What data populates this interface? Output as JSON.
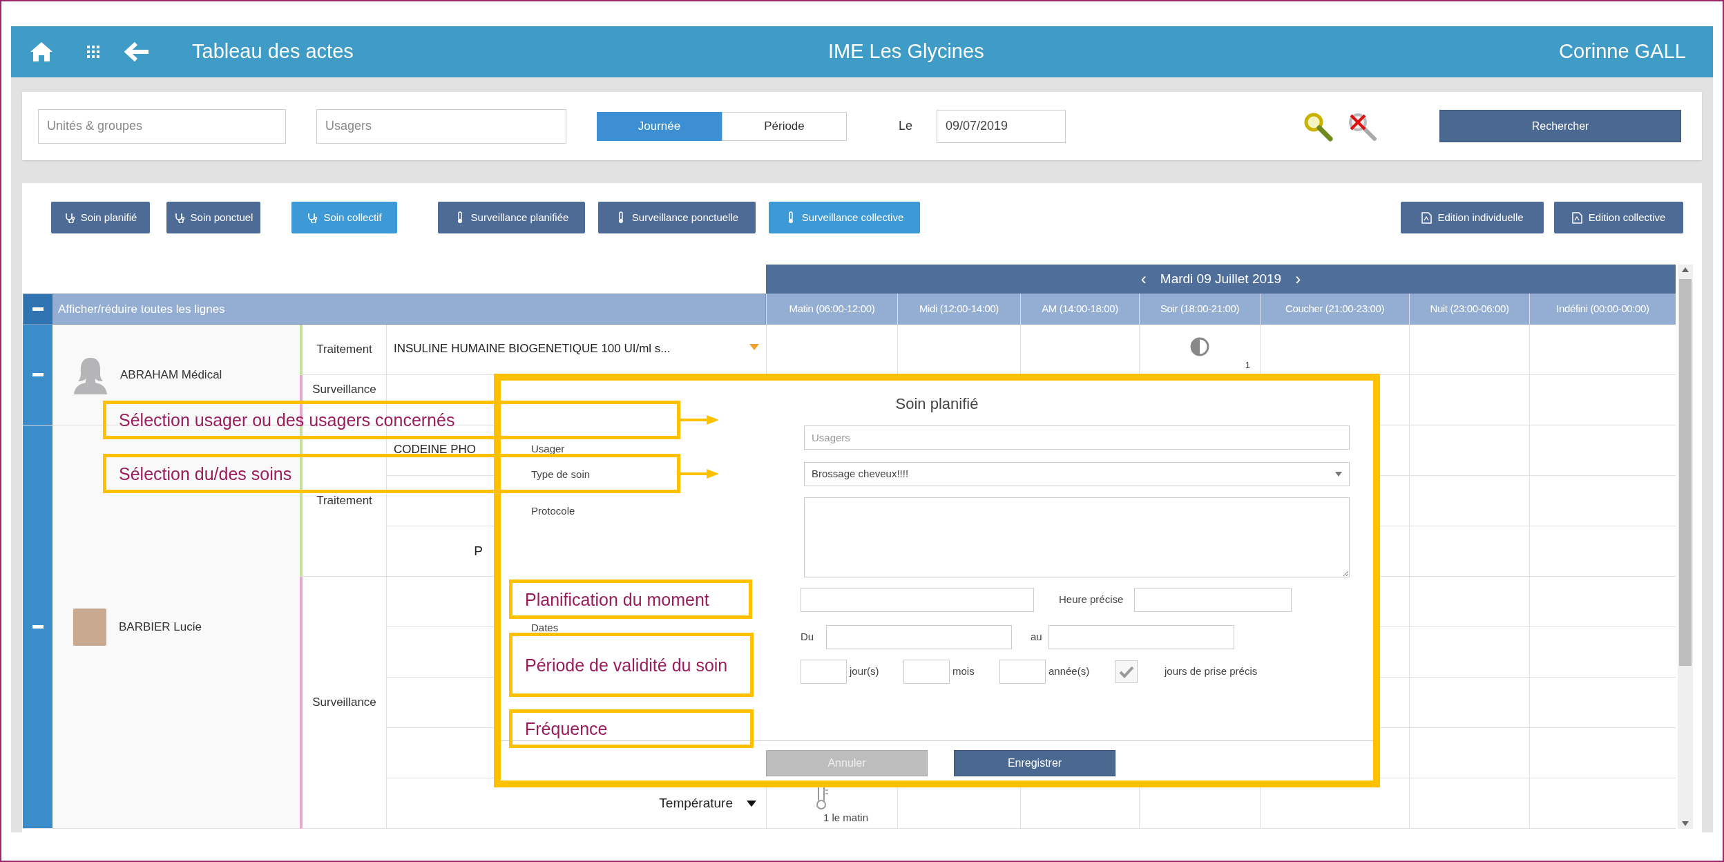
{
  "app_bar": {
    "title": "Tableau des actes",
    "center_title": "IME Les Glycines",
    "user": "Corinne GALL"
  },
  "filters": {
    "units_placeholder": "Unités & groupes",
    "users_placeholder": "Usagers",
    "modes": [
      {
        "label": "Journée",
        "selected": true
      },
      {
        "label": "Période",
        "selected": false
      }
    ],
    "date_label": "Le",
    "date_value": "09/07/2019",
    "search_button": "Rechercher"
  },
  "toolbar_left": [
    {
      "label": "Soin planifié",
      "kind": "soin",
      "highlighted": false
    },
    {
      "label": "Soin ponctuel",
      "kind": "soin",
      "highlighted": false
    },
    {
      "label": "Soin collectif",
      "kind": "soin",
      "highlighted": true
    },
    {
      "label": "Surveillance planifiée",
      "kind": "surveillance",
      "highlighted": false
    },
    {
      "label": "Surveillance ponctuelle",
      "kind": "surveillance",
      "highlighted": false
    },
    {
      "label": "Surveillance collective",
      "kind": "surveillance",
      "highlighted": true
    }
  ],
  "toolbar_right": [
    {
      "label": "Edition individuelle",
      "kind": "edition",
      "highlighted": false
    },
    {
      "label": "Edition collective",
      "kind": "edition",
      "highlighted": false
    }
  ],
  "table": {
    "prev": "‹",
    "date": "Mardi 09 Juillet 2019",
    "next": "›",
    "toggle_label": "Afficher/réduire toutes les lignes",
    "columns": [
      "Matin (06:00-12:00)",
      "Midi (12:00-14:00)",
      "AM (14:00-18:00)",
      "Soir (18:00-21:00)",
      "Coucher (21:00-23:00)",
      "Nuit (23:00-06:00)",
      "Indéfini (00:00-00:00)"
    ],
    "patients": [
      {
        "name": "ABRAHAM Médical",
        "photo": false,
        "expanded": true,
        "groups": [
          {
            "category": "Traitement",
            "kind": "traitement",
            "rows": [
              {
                "label": "INSULINE HUMAINE BIOGENETIQUE 100 UI/ml s...",
                "right_aligned": false,
                "caret": true,
                "cells": [
                  null,
                  null,
                  null,
                  {
                    "kind": "dose",
                    "text": "1"
                  },
                  null,
                  null,
                  null
                ]
              }
            ]
          },
          {
            "category": "Surveillance",
            "kind": "surveillance",
            "label_at_top": true,
            "rows": [
              {
                "cells": [
                  null,
                  null,
                  null,
                  null,
                  null,
                  null,
                  null
                ]
              }
            ]
          }
        ]
      },
      {
        "name": "BARBIER Lucie",
        "photo": true,
        "expanded": true,
        "groups": [
          {
            "category": "Traitement",
            "kind": "traitement",
            "rows": [
              {
                "label": "CODEINE PHO",
                "right_aligned": false,
                "cells": [
                  null,
                  null,
                  null,
                  null,
                  null,
                  null,
                  null
                ]
              },
              {
                "cells": [
                  null,
                  null,
                  null,
                  null,
                  null,
                  null,
                  null
                ]
              },
              {
                "label": "P",
                "right_aligned": true,
                "caret": false,
                "cells": [
                  null,
                  null,
                  null,
                  null,
                  null,
                  null,
                  null
                ]
              }
            ]
          },
          {
            "category": "Surveillance",
            "kind": "surveillance",
            "rows": [
              {
                "cells": [
                  null,
                  null,
                  null,
                  null,
                  null,
                  null,
                  null
                ]
              },
              {
                "cells": [
                  null,
                  null,
                  null,
                  null,
                  null,
                  null,
                  null
                ]
              },
              {
                "cells": [
                  null,
                  null,
                  null,
                  null,
                  null,
                  null,
                  null
                ]
              },
              {
                "cells": [
                  null,
                  null,
                  null,
                  null,
                  null,
                  null,
                  null
                ]
              },
              {
                "label": "Température",
                "right_aligned": true,
                "caret": true,
                "cells": [
                  {
                    "kind": "measure",
                    "text": "1 le matin"
                  },
                  null,
                  null,
                  null,
                  null,
                  null,
                  null
                ]
              }
            ]
          }
        ]
      }
    ]
  },
  "modal": {
    "title": "Soin planifié",
    "user_label": "Usager",
    "user_placeholder": "Usagers",
    "care_type_label": "Type de soin",
    "care_type_value": "Brossage cheveux!!!!",
    "protocol_label": "Protocole",
    "time_label": "Heure précise",
    "dates_label": "Dates",
    "from_label": "Du",
    "to_label": "au",
    "frequency_units": [
      "jour(s)",
      "mois",
      "année(s)"
    ],
    "precise_days": {
      "label": "jours de prise précis",
      "checked": true
    },
    "buttons": [
      {
        "label": "Annuler",
        "kind": "secondary"
      },
      {
        "label": "Enregistrer",
        "kind": "primary"
      }
    ]
  },
  "callouts": [
    {
      "text": "Sélection usager ou des usagers concernés",
      "arrow": true
    },
    {
      "text": "Sélection du/des  soins",
      "arrow": true
    },
    {
      "text": "Planification du moment",
      "arrow": false
    },
    {
      "text": "Période de validité du soin",
      "arrow": false
    },
    {
      "text": "Fréquence",
      "arrow": false
    }
  ]
}
